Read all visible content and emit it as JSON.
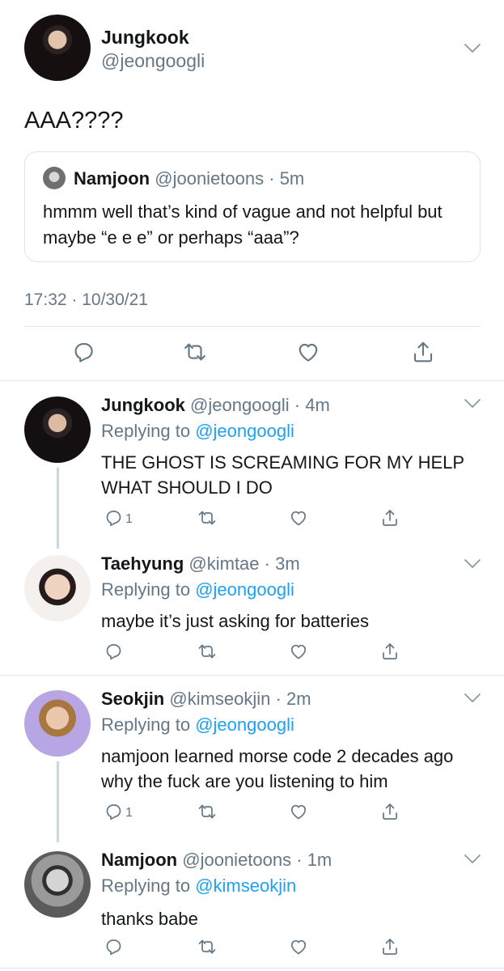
{
  "main_tweet": {
    "name": "Jungkook",
    "handle": "@jeongoogli",
    "text": "AAA????",
    "quote": {
      "name": "Namjoon",
      "handle": "@joonietoons",
      "time": "5m",
      "text": "hmmm well that’s kind of vague and not helpful but maybe “e e e” or perhaps “aaa”?"
    },
    "timestamp": "17:32 · 10/30/21"
  },
  "replies": [
    {
      "name": "Jungkook",
      "handle": "@jeongoogli",
      "time": "4m",
      "replying_label": "Replying to",
      "replying_to": "@jeongoogli",
      "text": "THE GHOST IS SCREAMING FOR MY HELP WHAT SHOULD I DO",
      "reply_count": "1"
    },
    {
      "name": "Taehyung",
      "handle": "@kimtae",
      "time": "3m",
      "replying_label": "Replying to",
      "replying_to": "@jeongoogli",
      "text": "maybe it’s just asking for batteries",
      "reply_count": ""
    },
    {
      "name": "Seokjin",
      "handle": "@kimseokjin",
      "time": "2m",
      "replying_label": "Replying to",
      "replying_to": "@jeongoogli",
      "text": "namjoon learned morse code 2 decades ago why the fuck are you listening to him",
      "reply_count": "1"
    },
    {
      "name": "Namjoon",
      "handle": "@joonietoons",
      "time": "1m",
      "replying_label": "Replying to",
      "replying_to": "@kimseokjin",
      "text": "thanks babe",
      "reply_count": ""
    }
  ],
  "icons": {
    "reply": "reply-icon",
    "retweet": "retweet-icon",
    "like": "heart-icon",
    "share": "share-icon",
    "menu": "chevron-down-icon"
  },
  "colors": {
    "accent": "#1da1f2",
    "muted": "#657786",
    "border": "#e1e8ed",
    "text": "#14171a"
  }
}
